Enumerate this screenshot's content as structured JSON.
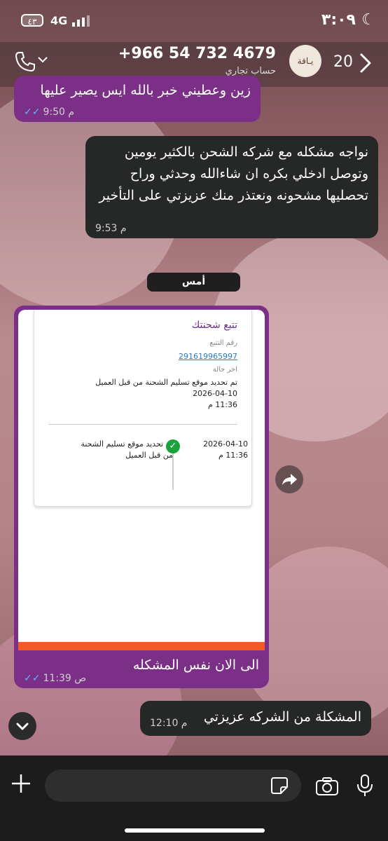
{
  "status_bar": {
    "time": "٣:٠٩",
    "network": "4G",
    "battery": "٤٣"
  },
  "header": {
    "unread_count": "20",
    "contact_name": "+966 54 732 4679",
    "account_type": "حساب تجاري",
    "avatar_text": "يـاقة"
  },
  "messages": [
    {
      "dir": "in",
      "text": "زين وعطيني خبر بالله ايس يصير عليها",
      "time": "9:50 م"
    },
    {
      "dir": "out",
      "text": "نواجه مشكله مع شركه الشحن بالكثير يومين وتوصل ادخلي بكره ان شاءالله وحدثي وراح تحصليها مشحونه ونعتذر منك عزيزتي على التأخير",
      "time": "9:53 م"
    }
  ],
  "date_divider": "أمس",
  "tracking_card": {
    "title": "تتبع شحنتك",
    "tracking_label": "رقم التتبع",
    "tracking_number": "291619965997",
    "last_status_label": "اخر حالة",
    "last_status": "تم تحديد موقع تسليم الشحنة من قبل العميل",
    "date": "2026-04-10",
    "time": "11:36 م",
    "event_text_line1": "تم تحديد موقع تسليم الشحنة",
    "event_text_line2": "من قبل العميل",
    "event_date": "2026-04-10",
    "event_time": "11:36 م"
  },
  "image_message": {
    "caption": "الى الان نفس المشكله",
    "time": "11:39 ص"
  },
  "last_message": {
    "text": "المشكلة من الشركه عزيزتي",
    "time": "12:10 م"
  },
  "colors": {
    "incoming_bubble": "#7b2f86",
    "outgoing_bubble": "#262827",
    "read_ticks": "#64b5ff",
    "check_green": "#1aa33a",
    "orange_bar": "#f15a22"
  }
}
